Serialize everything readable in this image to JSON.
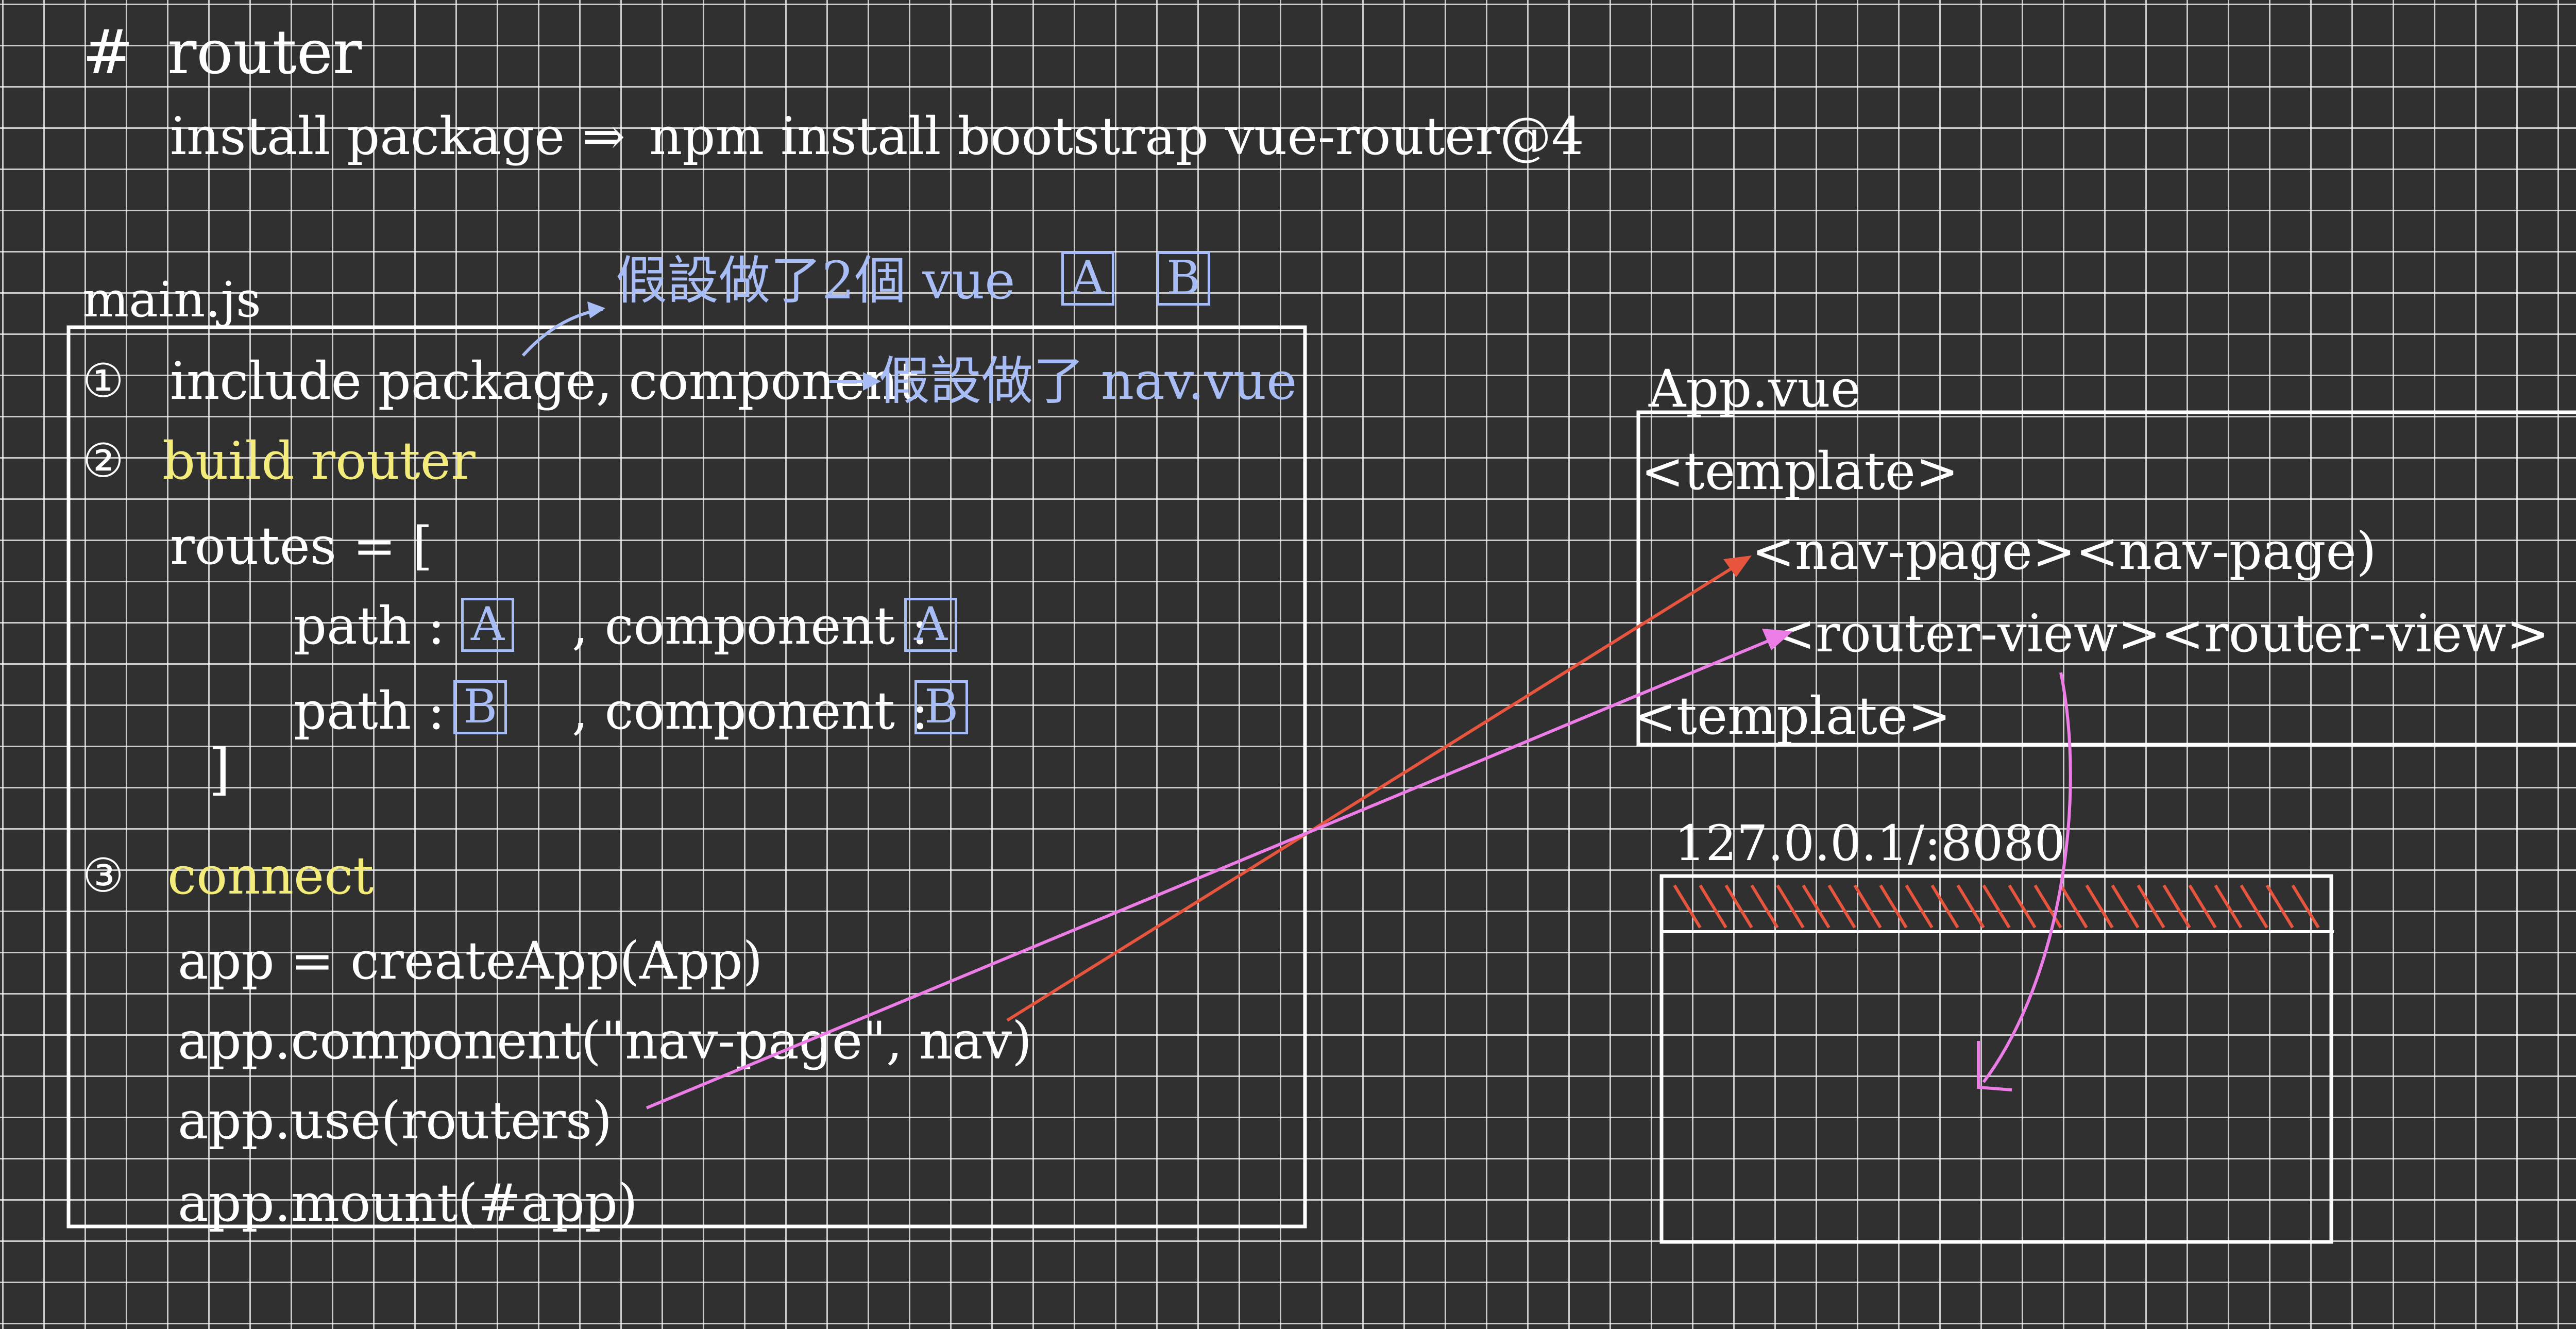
{
  "colors": {
    "background": "#303030",
    "grid": "#f5f5f5",
    "ink_white": "#ffffff",
    "ink_blue": "#a8bdf6",
    "ink_yellow": "#f3ec7a",
    "arrow_red": "#e8553f",
    "arrow_pink": "#ec7ce6"
  },
  "heading": {
    "hash": "#",
    "title": "router"
  },
  "install": {
    "label": "install package",
    "arrow": "⇒",
    "command": "npm install bootstrap  vue-router@4"
  },
  "main_js": {
    "label": "main.js",
    "note_vue": "假設做了2個 vue",
    "note_box_a": "A",
    "note_box_b": "B",
    "step1_num": "①",
    "step1_text": "include package, component",
    "step1_note": "假設做了 nav.vue",
    "step2_num": "②",
    "step2_title": "build router",
    "routes_open": "routes = [",
    "route1_path_key": "path :",
    "route1_path_val": "A",
    "route1_comp_key": ", component :",
    "route1_comp_val": "A",
    "route2_path_key": "path :",
    "route2_path_val": "B",
    "route2_comp_key": ", component :",
    "route2_comp_val": "B",
    "routes_close": "]",
    "step3_num": "③",
    "step3_title": "connect",
    "code1": "app = createApp(App)",
    "code2": "app.component(\"nav-page\", nav)",
    "code3": "app.use(routers)",
    "code4": "app.mount(#app)"
  },
  "app_vue": {
    "label": "App.vue",
    "tpl_open": "<template>",
    "nav_line": "<nav-page><nav-page)",
    "router_line": "<router-view><router-view>",
    "tpl_close": "<template>"
  },
  "browser": {
    "url": "127.0.0.1/:8080"
  },
  "icons": {
    "red_arrow": "arrow-icon",
    "pink_arrow": "arrow-icon",
    "curve_arrow": "curved-arrow-icon"
  }
}
